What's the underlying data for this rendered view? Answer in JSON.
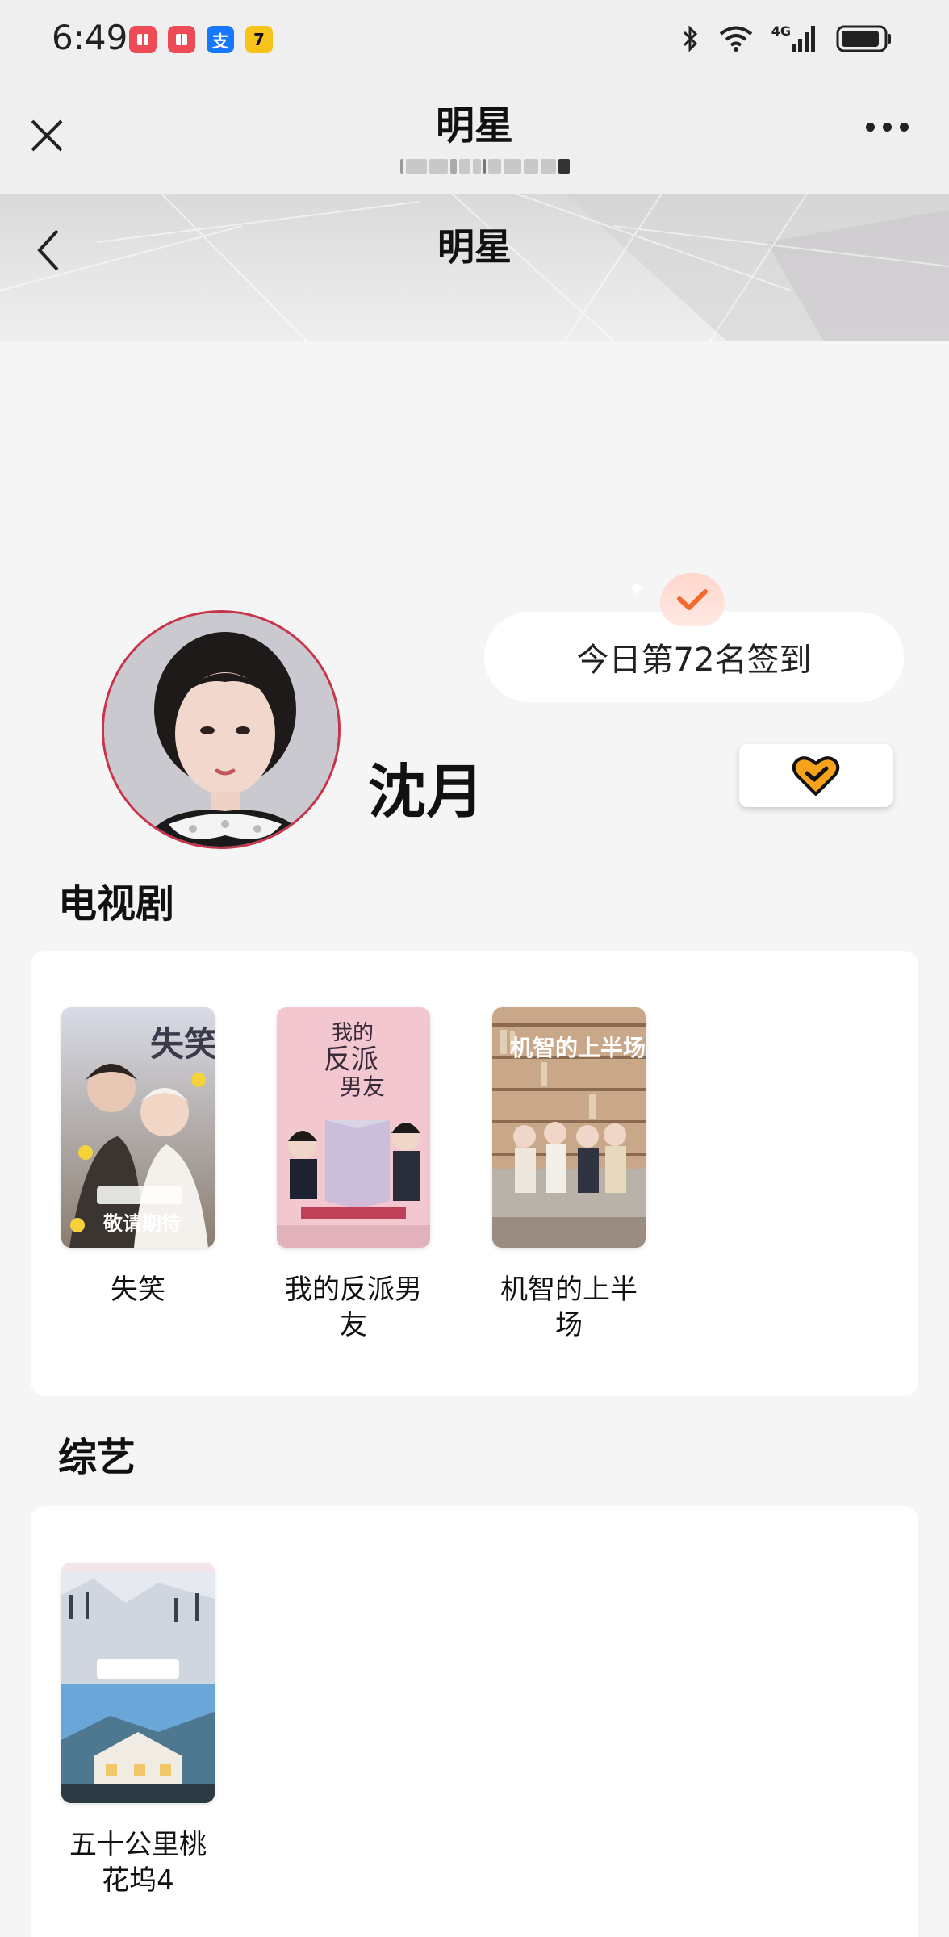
{
  "status_bar": {
    "time": "6:49",
    "notifications": [
      {
        "name": "red-book-notif-icon",
        "glyph": "",
        "color": "#ef4b56"
      },
      {
        "name": "red-book-notif-icon-2",
        "glyph": "",
        "color": "#ef4b56"
      },
      {
        "name": "alipay-notif-icon",
        "glyph": "支",
        "color": "#1677ff"
      },
      {
        "name": "seven-cats-notif-icon",
        "glyph": "7",
        "color": "#f7c31b"
      }
    ],
    "network": "4G"
  },
  "mini_app": {
    "title": "明星"
  },
  "page": {
    "title": "明星"
  },
  "profile": {
    "name": "沈月",
    "checkin_text": "今日第72名签到"
  },
  "sections": {
    "tv": {
      "title": "电视剧",
      "items": [
        {
          "title": "失笑"
        },
        {
          "title": "我的反派男友"
        },
        {
          "title": "机智的上半场"
        }
      ]
    },
    "variety": {
      "title": "综艺",
      "items": [
        {
          "title": "五十公里桃花坞4"
        }
      ]
    }
  },
  "colors": {
    "accent_orange": "#f26b2d",
    "heart_orange": "#f7a21b",
    "avatar_border": "#c8344a"
  }
}
